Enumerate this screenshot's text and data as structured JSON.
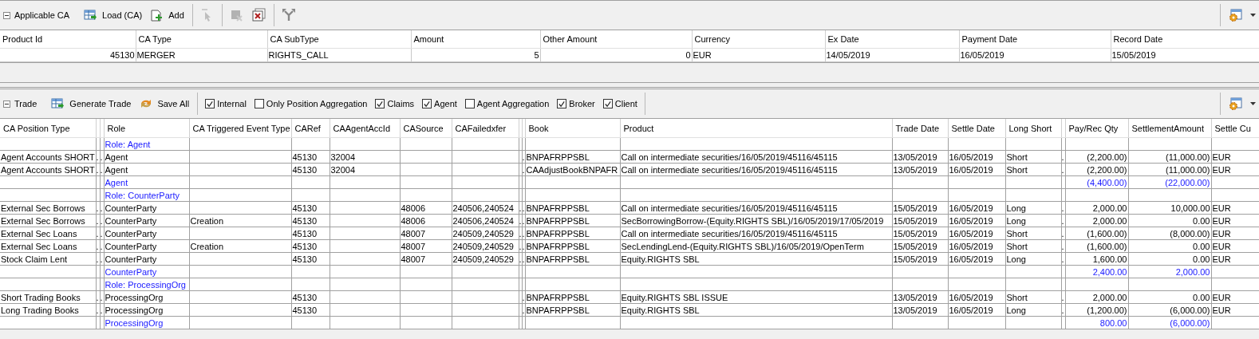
{
  "ca_panel": {
    "toolbar": {
      "title": "Applicable CA",
      "expanded": true,
      "buttons": [
        {
          "label": "Load (CA)",
          "kind": "load"
        },
        {
          "label": "Add",
          "kind": "add"
        }
      ],
      "icon_groups": [
        [
          {
            "kind": "pointer",
            "disabled": true
          }
        ],
        [
          {
            "kind": "delete",
            "disabled": true
          },
          {
            "kind": "delete-window",
            "disabled": false
          }
        ],
        [
          {
            "kind": "fork",
            "disabled": false
          }
        ]
      ],
      "right_icon": {
        "kind": "settings"
      }
    },
    "table": {
      "columns": [
        "Product Id",
        "CA Type",
        "CA SubType",
        "Amount",
        "Other Amount",
        "Currency",
        "Ex Date",
        "Payment Date",
        "Record Date"
      ],
      "rows": [
        [
          "45130",
          "MERGER",
          "RIGHTS_CALL",
          "5",
          "0",
          "EUR",
          "14/05/2019",
          "16/05/2019",
          "15/05/2019"
        ]
      ]
    }
  },
  "trade_panel": {
    "toolbar": {
      "title": "Trade",
      "expanded": true,
      "buttons": [
        {
          "label": "Generate Trade",
          "kind": "load"
        },
        {
          "label": "Save All",
          "kind": "save"
        }
      ],
      "checkboxes": [
        {
          "label": "Internal",
          "checked": true
        },
        {
          "label": "Only Position Aggregation",
          "checked": false
        },
        {
          "label": "Claims",
          "checked": true
        },
        {
          "label": "Agent",
          "checked": true
        },
        {
          "label": "Agent Aggregation",
          "checked": false
        },
        {
          "label": "Broker",
          "checked": true
        },
        {
          "label": "Client",
          "checked": true
        }
      ],
      "right_icon": {
        "kind": "settings"
      }
    },
    "table": {
      "columns": [
        "CA Position Type",
        null,
        null,
        "Role",
        "CA Triggered Event Type",
        "CARef",
        "CAAgentAccId",
        "CASource",
        "CAFailedxfer",
        null,
        null,
        "Book",
        "Product",
        "Trade Date",
        "Settle Date",
        "Long Short",
        null,
        "Pay/Rec Qty",
        "SettlementAmount",
        "Settle Cu"
      ],
      "rows": [
        {
          "kind": "group",
          "cells": [
            null,
            null,
            null,
            "Role: Agent",
            null,
            null,
            null,
            null,
            null,
            null,
            null,
            null,
            null,
            null,
            null,
            null,
            null,
            null,
            null,
            null
          ]
        },
        {
          "kind": "data",
          "cells": [
            "Agent Accounts SHORT",
            ".",
            ".",
            "Agent",
            null,
            "45130",
            "32004",
            null,
            null,
            null,
            ".",
            "BNPAFRPPSBL",
            "Call on intermediate securities/16/05/2019/45116/45115",
            "13/05/2019",
            "16/05/2019",
            "Short",
            ".",
            "(2,200.00)",
            "(11,000.00)",
            "EUR"
          ]
        },
        {
          "kind": "data",
          "cells": [
            "Agent Accounts SHORT",
            ".",
            ".",
            "Agent",
            null,
            "45130",
            "32004",
            null,
            null,
            null,
            ".",
            "CAAdjustBookBNPAFR",
            "Call on intermediate securities/16/05/2019/45116/45115",
            "13/05/2019",
            "16/05/2019",
            "Short",
            ".",
            "(2,200.00)",
            "(11,000.00)",
            "EUR"
          ]
        },
        {
          "kind": "total",
          "cells": [
            null,
            null,
            null,
            "Agent",
            null,
            null,
            null,
            null,
            null,
            null,
            null,
            null,
            null,
            null,
            null,
            null,
            null,
            "(4,400.00)",
            "(22,000.00)",
            null
          ]
        },
        {
          "kind": "group",
          "cells": [
            null,
            null,
            null,
            "Role: CounterParty",
            null,
            null,
            null,
            null,
            null,
            null,
            null,
            null,
            null,
            null,
            null,
            null,
            null,
            null,
            null,
            null
          ]
        },
        {
          "kind": "data",
          "cells": [
            "External Sec Borrows",
            ".",
            ".",
            "CounterParty",
            null,
            "45130",
            null,
            "48006",
            "240506,240524",
            ".",
            ".",
            "BNPAFRPPSBL",
            "Call on intermediate securities/16/05/2019/45116/45115",
            "15/05/2019",
            "16/05/2019",
            "Long",
            ".",
            "2,000.00",
            "10,000.00",
            "EUR"
          ]
        },
        {
          "kind": "data",
          "cells": [
            "External Sec Borrows",
            ".",
            ".",
            "CounterParty",
            "Creation",
            "45130",
            null,
            "48006",
            "240506,240524",
            ".",
            ".",
            "BNPAFRPPSBL",
            "SecBorrowingBorrow-(Equity.RIGHTS SBL)/16/05/2019/17/05/2019",
            "15/05/2019",
            "16/05/2019",
            "Long",
            ".",
            "2,000.00",
            "0.00",
            "EUR"
          ]
        },
        {
          "kind": "data",
          "cells": [
            "External Sec Loans",
            ".",
            ".",
            "CounterParty",
            null,
            "45130",
            null,
            "48007",
            "240509,240529",
            ".",
            ".",
            "BNPAFRPPSBL",
            "Call on intermediate securities/16/05/2019/45116/45115",
            "15/05/2019",
            "16/05/2019",
            "Short",
            ".",
            "(1,600.00)",
            "(8,000.00)",
            "EUR"
          ]
        },
        {
          "kind": "data",
          "cells": [
            "External Sec Loans",
            ".",
            ".",
            "CounterParty",
            "Creation",
            "45130",
            null,
            "48007",
            "240509,240529",
            ".",
            ".",
            "BNPAFRPPSBL",
            "SecLendingLend-(Equity.RIGHTS SBL)/16/05/2019/OpenTerm",
            "15/05/2019",
            "16/05/2019",
            "Short",
            ".",
            "(1,600.00)",
            "0.00",
            "EUR"
          ]
        },
        {
          "kind": "data",
          "cells": [
            "Stock Claim Lent",
            ".",
            ".",
            "CounterParty",
            null,
            "45130",
            null,
            "48007",
            "240509,240529",
            ".",
            ".",
            "BNPAFRPPSBL",
            "Equity.RIGHTS SBL",
            "15/05/2019",
            "16/05/2019",
            "Long",
            ".",
            "1,600.00",
            "0.00",
            "EUR"
          ]
        },
        {
          "kind": "total",
          "cells": [
            null,
            null,
            null,
            "CounterParty",
            null,
            null,
            null,
            null,
            null,
            null,
            null,
            null,
            null,
            null,
            null,
            null,
            null,
            "2,400.00",
            "2,000.00",
            null
          ]
        },
        {
          "kind": "group",
          "cells": [
            null,
            null,
            null,
            "Role: ProcessingOrg",
            null,
            null,
            null,
            null,
            null,
            null,
            null,
            null,
            null,
            null,
            null,
            null,
            null,
            null,
            null,
            null
          ]
        },
        {
          "kind": "data",
          "cells": [
            "Short Trading Books",
            ".",
            ".",
            "ProcessingOrg",
            null,
            "45130",
            null,
            null,
            null,
            null,
            ".",
            "BNPAFRPPSBL",
            "Equity.RIGHTS SBL ISSUE",
            "13/05/2019",
            "16/05/2019",
            "Short",
            ".",
            "2,000.00",
            "0.00",
            "EUR"
          ]
        },
        {
          "kind": "data",
          "cells": [
            "Long Trading Books",
            ".",
            ".",
            "ProcessingOrg",
            null,
            "45130",
            null,
            null,
            null,
            null,
            ".",
            "BNPAFRPPSBL",
            "Equity.RIGHTS SBL",
            "13/05/2019",
            "16/05/2019",
            "Long",
            ".",
            "(1,200.00)",
            "(6,000.00)",
            "EUR"
          ]
        },
        {
          "kind": "total",
          "cells": [
            null,
            null,
            null,
            "ProcessingOrg",
            null,
            null,
            null,
            null,
            null,
            null,
            null,
            null,
            null,
            null,
            null,
            null,
            null,
            "800.00",
            "(6,000.00)",
            null
          ]
        }
      ]
    }
  }
}
